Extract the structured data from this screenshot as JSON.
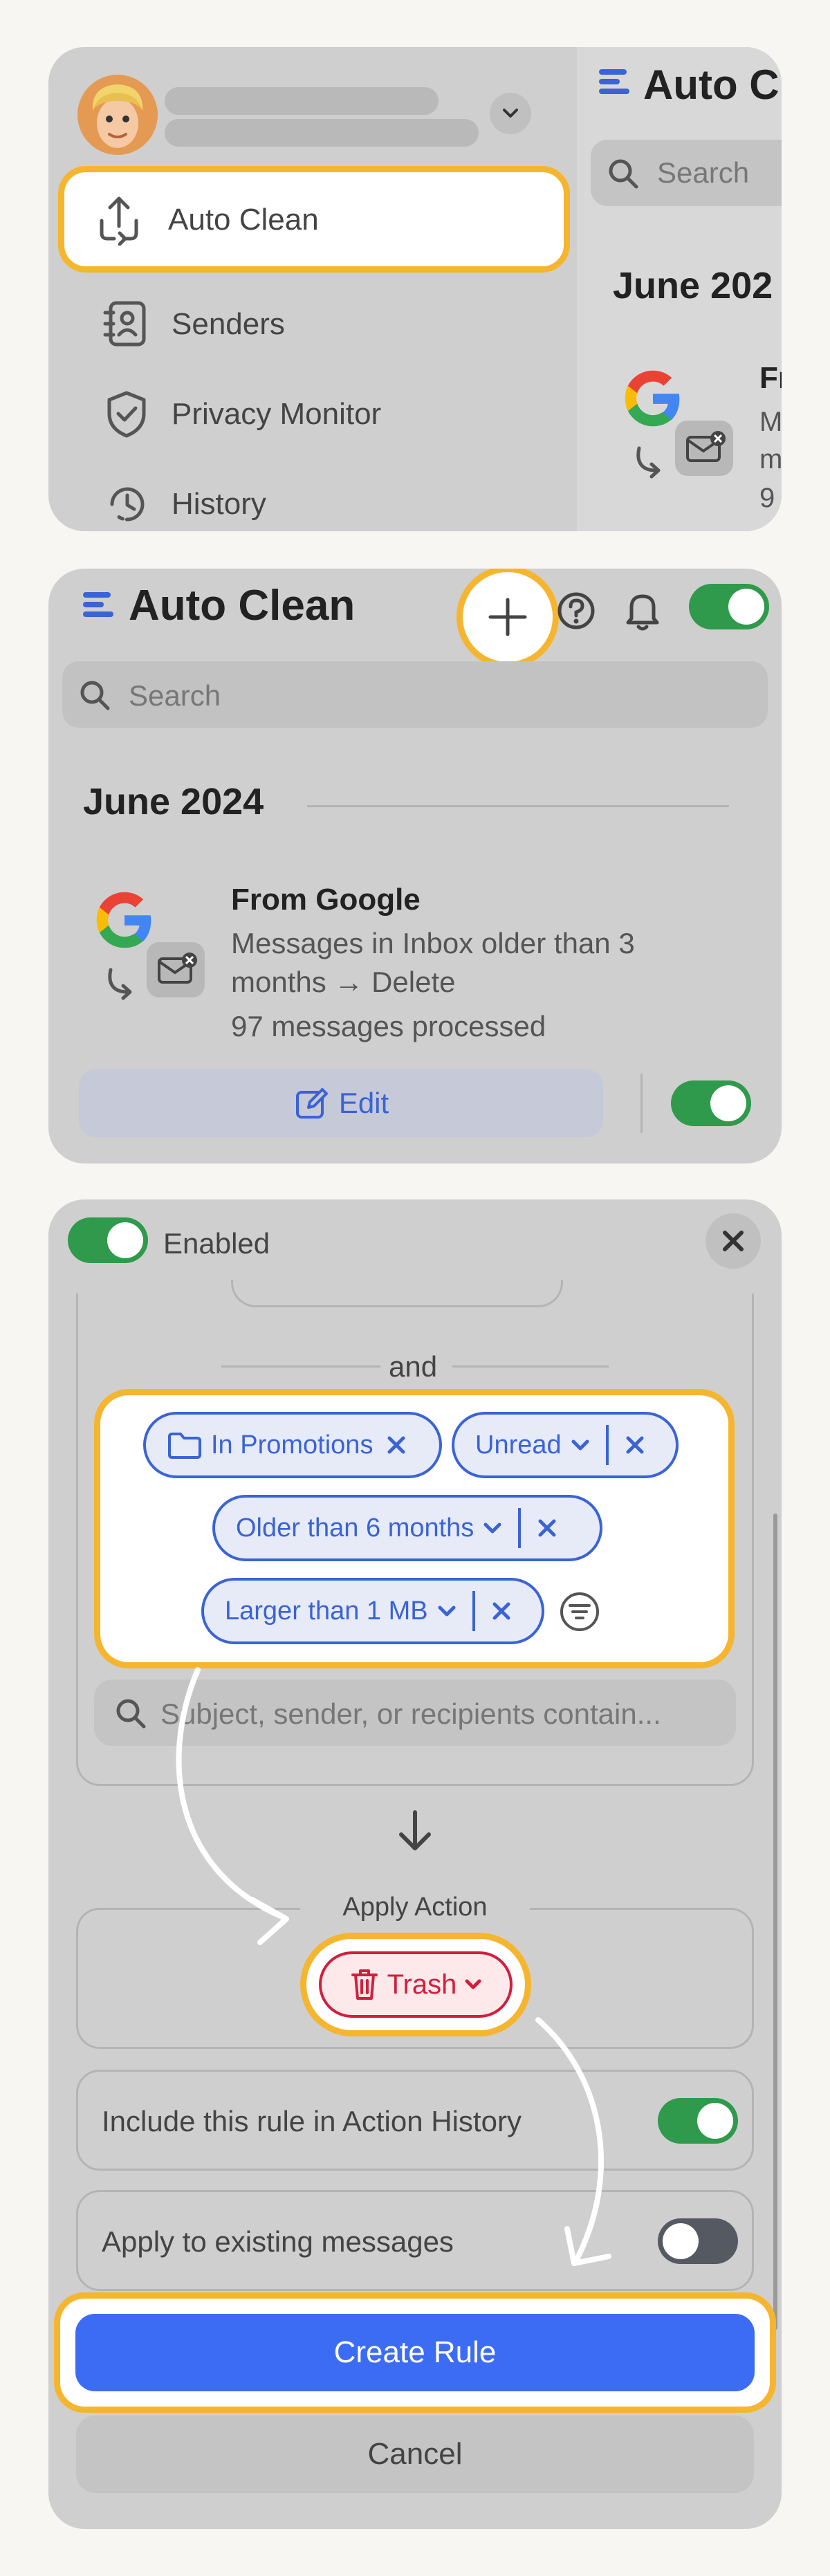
{
  "sidebar": {
    "items": [
      {
        "label": "Auto Clean",
        "icon": "recycle-arrows-icon"
      },
      {
        "label": "Senders",
        "icon": "contact-book-icon"
      },
      {
        "label": "Privacy Monitor",
        "icon": "shield-check-icon"
      },
      {
        "label": "History",
        "icon": "history-clock-icon"
      }
    ]
  },
  "peek": {
    "title": "Auto C",
    "search_placeholder": "Search",
    "month": "June 202",
    "rule_from": "Fr",
    "rule_lines": [
      "M",
      "m",
      "9"
    ]
  },
  "main": {
    "title": "Auto Clean",
    "search_placeholder": "Search",
    "month": "June 2024",
    "rule": {
      "title": "From Google",
      "description_line1": "Messages in Inbox older than 3",
      "description_line2": "months → Delete",
      "processed": "97 messages processed",
      "edit_label": "Edit"
    }
  },
  "editor": {
    "enabled_label": "Enabled",
    "and_label": "and",
    "conditions": [
      {
        "label": "In Promotions",
        "icon": "folder-icon"
      },
      {
        "label": "Unread"
      },
      {
        "label": "Older than 6 months"
      },
      {
        "label": "Larger than 1 MB"
      }
    ],
    "search_placeholder": "Subject, sender, or recipients contain...",
    "apply_action_label": "Apply Action",
    "action": "Trash",
    "include_history_label": "Include this rule in Action History",
    "apply_existing_label": "Apply to existing messages",
    "create_label": "Create Rule",
    "cancel_label": "Cancel"
  },
  "colors": {
    "highlight": "#f6b52e",
    "accent_blue": "#3a63d6",
    "toggle_on": "#2f9a4c",
    "danger_red": "#d11f3c",
    "create_button": "#3d6cf4"
  }
}
